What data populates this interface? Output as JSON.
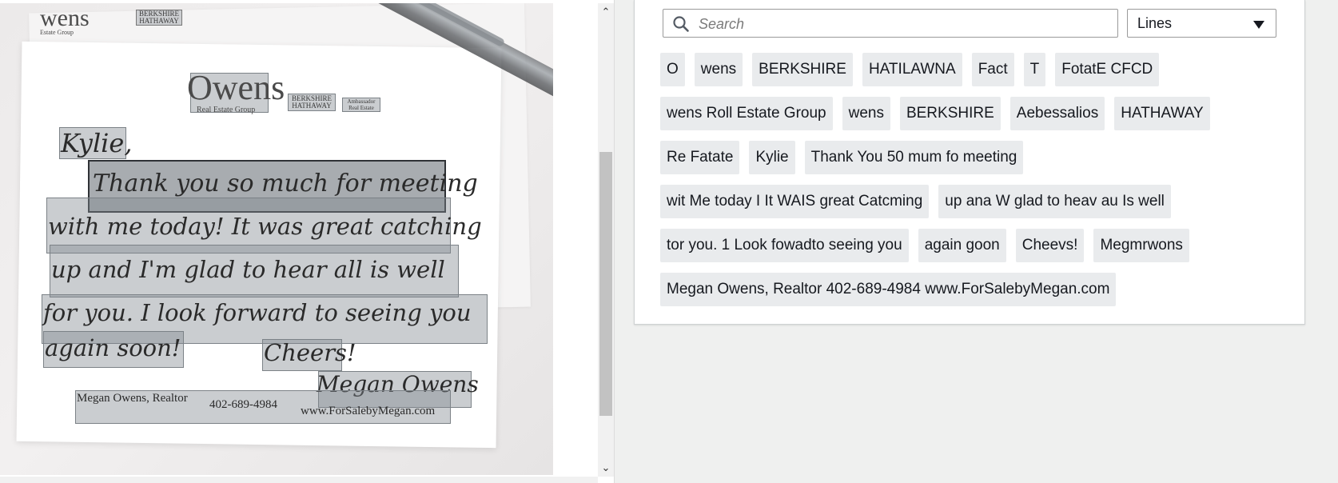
{
  "viewer": {
    "note_lines": [
      "Kylie,",
      "Thank you so much for meeting",
      "with me today! It was great catching",
      "up and I'm glad to hear all is well",
      "for you. I look forward to seeing you",
      "again soon!",
      "Cheers!",
      "Megan Owens"
    ],
    "logo_text": "Owens",
    "logo_sub": "Real Estate Group",
    "logo_brand_1": "BERKSHIRE",
    "logo_brand_2": "HATHAWAY",
    "logo_badge_1": "Ambassador",
    "logo_badge_2": "Real Estate",
    "small_logo_text": "wens",
    "small_logo_sub": "Estate Group",
    "footer_name": "Megan Owens, Realtor",
    "footer_phone": "402-689-4984",
    "footer_url": "www.ForSalebyMegan.com",
    "scroll_up": "⌃",
    "scroll_down": "⌄"
  },
  "search": {
    "placeholder": "Search",
    "icon": "search-icon"
  },
  "filter": {
    "selected": "Lines",
    "icon": "caret-down-icon"
  },
  "results": {
    "rows": [
      [
        "O",
        "wens",
        "BERKSHIRE",
        "HATILAWNA",
        "Fact",
        "T",
        "FotatE CFCD"
      ],
      [
        "wens Roll Estate Group",
        "wens",
        "BERKSHIRE",
        "Aebessalios",
        "HATHAWAY"
      ],
      [
        "Re Fatate",
        "Kylie",
        "Thank You 50 mum fo meeting"
      ],
      [
        "wit Me today I It WAIS great Catcming",
        "up ana W glad to heav au Is well"
      ],
      [
        "tor you. 1 Look fowadto seeing you",
        "again goon",
        "Cheevs!",
        "Megmrwons"
      ],
      [
        "Megan Owens, Realtor 402-689-4984 www.ForSalebyMegan.com"
      ]
    ]
  },
  "colors": {
    "background": "#eff0ef",
    "chip": "#e9ebed",
    "selected_box": "#2f3236",
    "text": "#16191f"
  }
}
